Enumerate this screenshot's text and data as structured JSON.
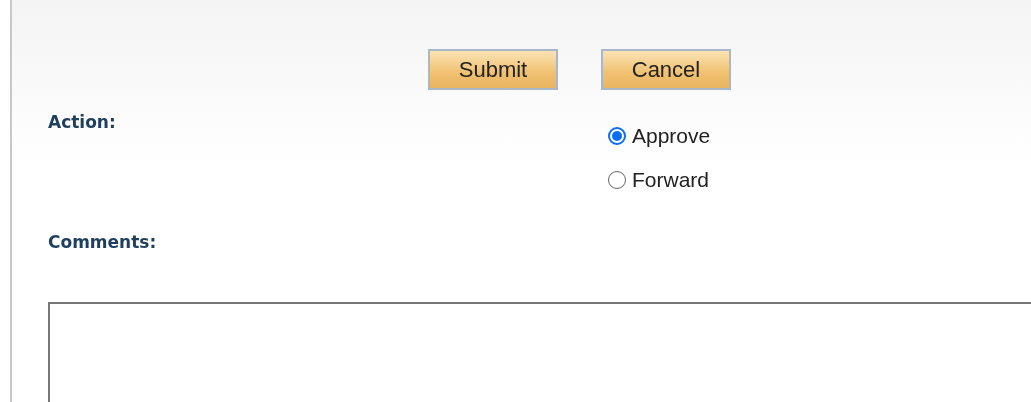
{
  "buttons": [
    {
      "label": "Submit"
    },
    {
      "label": "Cancel"
    }
  ],
  "action": {
    "label": "Action:",
    "options": [
      {
        "label": "Approve",
        "selected": true
      },
      {
        "label": "Forward",
        "selected": false
      }
    ]
  },
  "comments": {
    "label": "Comments:"
  }
}
